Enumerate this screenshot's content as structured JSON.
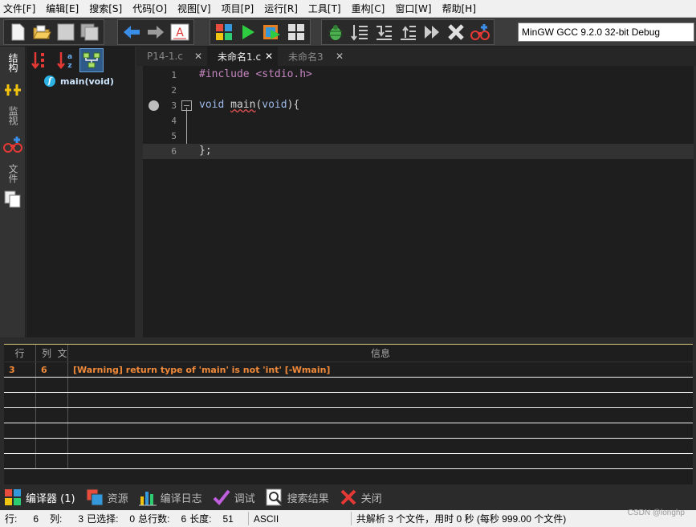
{
  "menu": [
    "文件[F]",
    "编辑[E]",
    "搜索[S]",
    "代码[O]",
    "视图[V]",
    "项目[P]",
    "运行[R]",
    "工具[T]",
    "重构[C]",
    "窗口[W]",
    "帮助[H]"
  ],
  "toolbar": {
    "compiler": "MinGW GCC 9.2.0 32-bit Debug",
    "icons": [
      "new-file-icon",
      "open-folder-icon",
      "save-icon",
      "save-all-icon",
      "back-arrow-icon",
      "forward-arrow-icon",
      "format-code-icon",
      "compile-icon",
      "run-icon",
      "compile-run-icon",
      "rebuild-icon",
      "debug-icon",
      "step-icon",
      "step-into-icon",
      "step-out-icon",
      "continue-icon",
      "stop-icon",
      "add-watch-icon"
    ],
    "colors": {
      "run": "#2ecc40",
      "back": "#3b8ee8",
      "stop": "#e0e0e0",
      "debug": "#4caf50"
    }
  },
  "sidebar": {
    "tabs": [
      "结构",
      "监视",
      "文件"
    ]
  },
  "structure": {
    "items": [
      {
        "icon": "f",
        "label": "main(void)"
      }
    ]
  },
  "editor": {
    "tabs": [
      {
        "label": "P14-1.c",
        "active": false
      },
      {
        "label": "未命名1.c",
        "active": true
      },
      {
        "label": "未命名3",
        "active": false
      }
    ],
    "lines": [
      {
        "num": "1",
        "parts": [
          {
            "t": "#include <stdio.h>",
            "c": "tok-pre"
          }
        ]
      },
      {
        "num": "2",
        "parts": []
      },
      {
        "num": "3",
        "parts": [
          {
            "t": "void ",
            "c": "tok-kw"
          },
          {
            "t": "main",
            "c": "tok-fn"
          },
          {
            "t": "(",
            "c": "tok-txt"
          },
          {
            "t": "void",
            "c": "tok-kw"
          },
          {
            "t": "){",
            "c": "tok-txt"
          }
        ]
      },
      {
        "num": "4",
        "parts": []
      },
      {
        "num": "5",
        "parts": []
      },
      {
        "num": "6",
        "parts": [
          {
            "t": "};",
            "c": "tok-txt"
          }
        ]
      }
    ],
    "current_line": 6,
    "breakpoint_line": 3
  },
  "messages": {
    "columns": [
      "行",
      "列",
      "文",
      "信息"
    ],
    "rows": [
      {
        "line": "3",
        "col": "6",
        "file": "",
        "message": "[Warning] return type of 'main' is not 'int' [-Wmain]"
      }
    ]
  },
  "bottom_tabs": [
    {
      "label": "编译器 (1)",
      "icon": "compiler-icon",
      "active": true
    },
    {
      "label": "资源",
      "icon": "resources-icon",
      "active": false
    },
    {
      "label": "编译日志",
      "icon": "compile-log-icon",
      "active": false
    },
    {
      "label": "调试",
      "icon": "debug-check-icon",
      "active": false
    },
    {
      "label": "搜索结果",
      "icon": "search-results-icon",
      "active": false
    },
    {
      "label": "关闭",
      "icon": "close-icon",
      "active": false
    }
  ],
  "status": {
    "row_label": "行:",
    "row": "6",
    "col_label": "列:",
    "col": "3",
    "sel_label": "已选择:",
    "sel": "0",
    "total_label": "总行数:",
    "total": "6",
    "len_label": "长度:",
    "len": "51",
    "encoding": "ASCII",
    "parse_msg": "共解析 3 个文件，用时 0 秒 (每秒 999.00 个文件)"
  },
  "watermark": "CSDN @longhp"
}
